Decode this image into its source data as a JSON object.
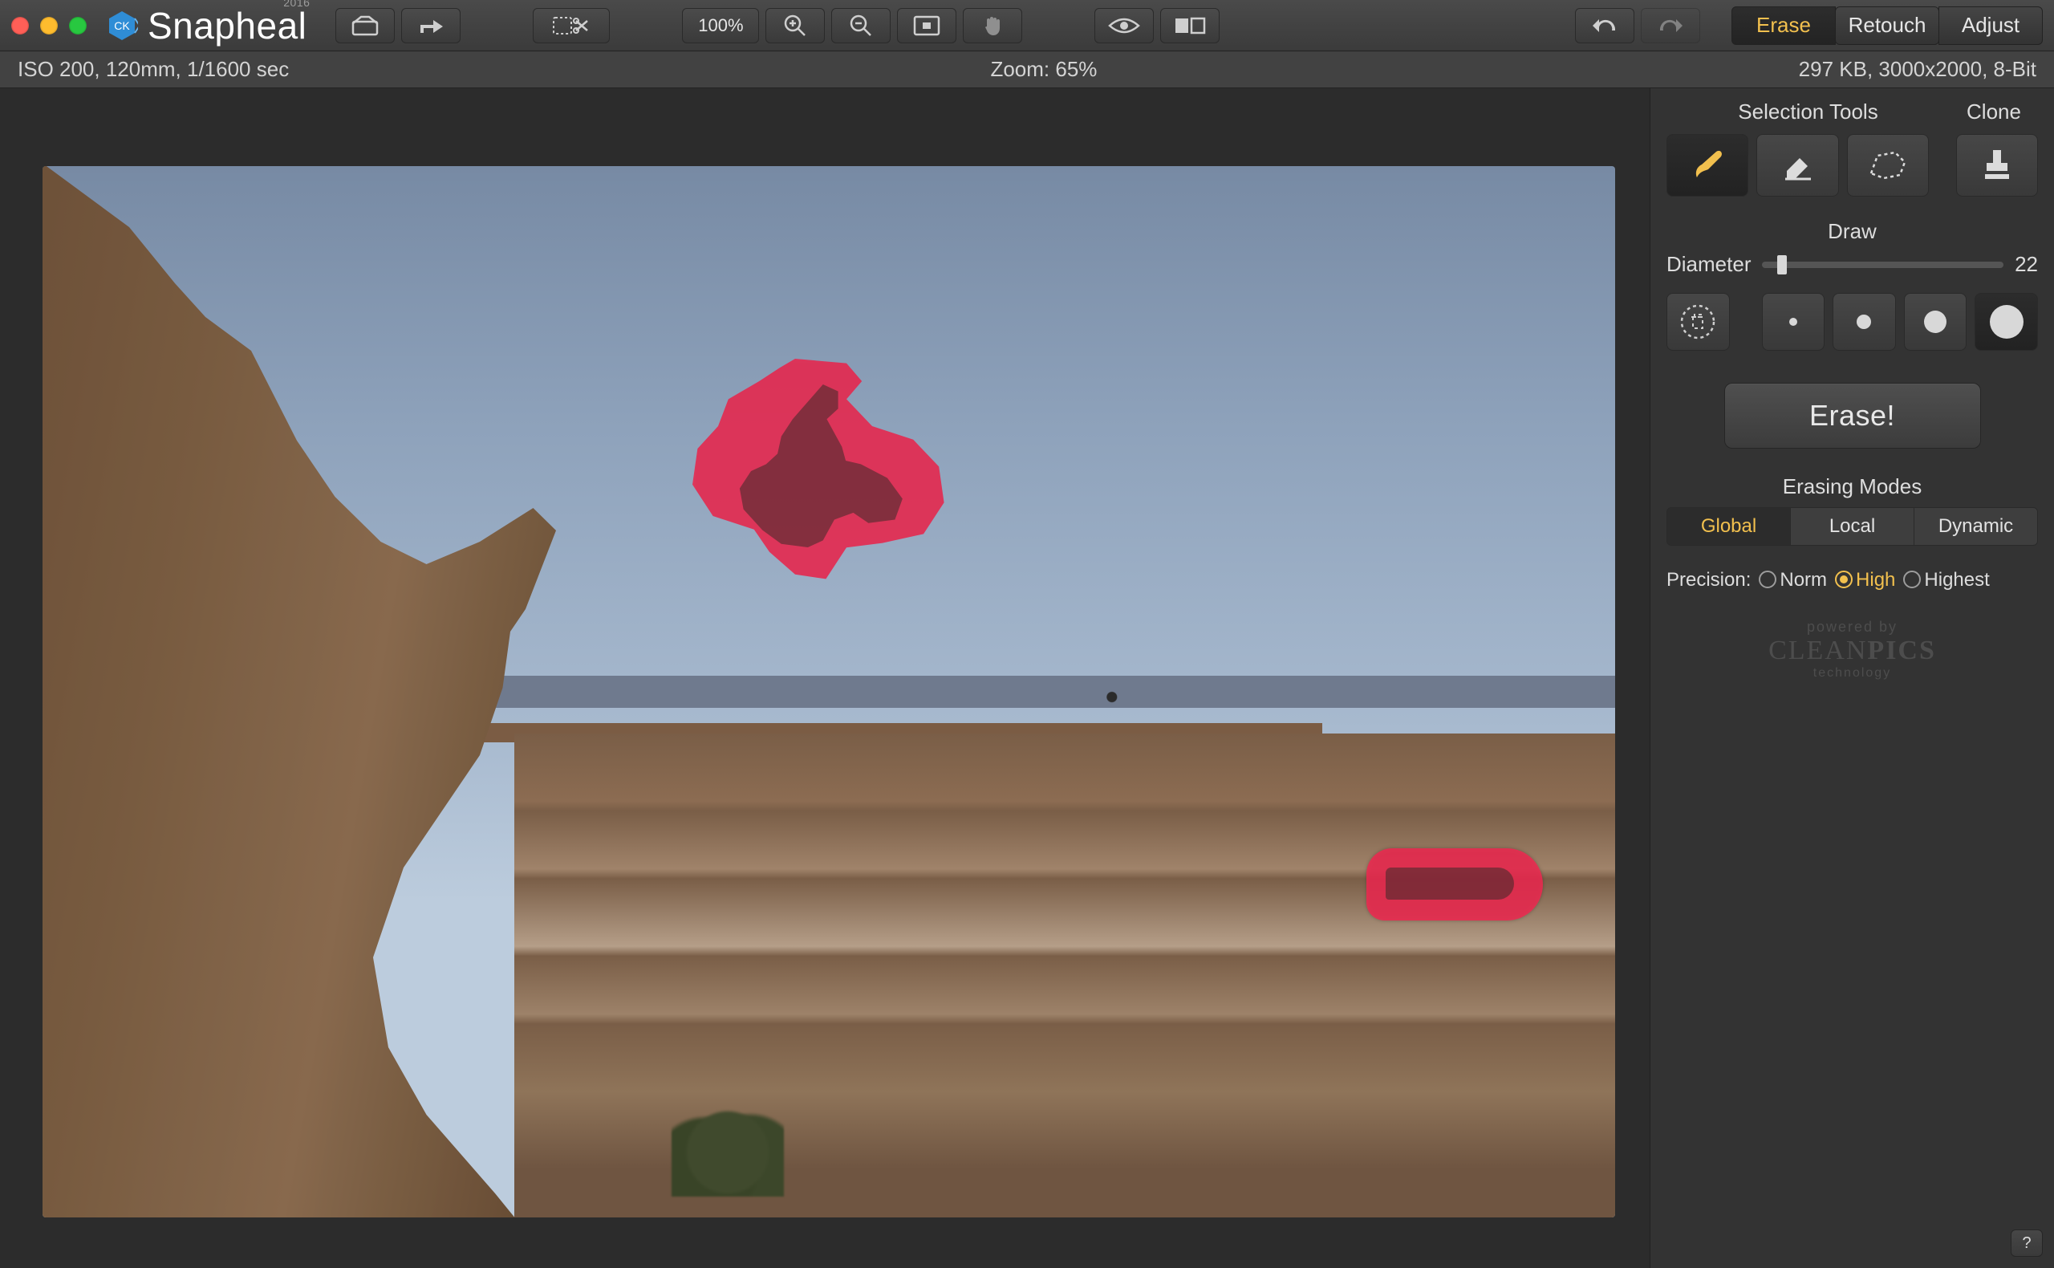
{
  "app": {
    "name": "Snapheal",
    "year": "2016",
    "badge": "CK"
  },
  "toolbar": {
    "open_icon": "box-open-icon",
    "share_icon": "share-arrow-icon",
    "crop_icon": "crop-scissors-icon",
    "zoom_pct": "100%",
    "zoom_in_icon": "zoom-in-icon",
    "zoom_out_icon": "zoom-out-icon",
    "fit_icon": "fit-screen-icon",
    "hand_icon": "hand-pan-icon",
    "preview_icon": "eye-preview-icon",
    "compare_icon": "compare-split-icon",
    "undo_icon": "undo-arrow-icon",
    "redo_icon": "redo-arrow-icon"
  },
  "modes": {
    "tabs": [
      "Erase",
      "Retouch",
      "Adjust"
    ],
    "active": "Erase"
  },
  "infobar": {
    "left": "ISO 200, 120mm, 1/1600 sec",
    "zoom": "Zoom: 65%",
    "right": "297 KB, 3000x2000, 8-Bit"
  },
  "panel": {
    "selection_tools_label": "Selection Tools",
    "clone_label": "Clone",
    "tools": [
      {
        "id": "brush-tool",
        "icon": "brush-icon",
        "active": true
      },
      {
        "id": "eraser-tool",
        "icon": "eraser-icon",
        "active": false
      },
      {
        "id": "lasso-tool",
        "icon": "lasso-icon",
        "active": false
      }
    ],
    "clone_tool": {
      "id": "clone-stamp-tool",
      "icon": "stamp-icon"
    },
    "draw_label": "Draw",
    "diameter_label": "Diameter",
    "diameter_value": "22",
    "diameter_thumb_pct": 6,
    "presets": [
      {
        "id": "clear-selection",
        "icon": "trash-dashed-icon"
      },
      {
        "id": "brush-size-xs",
        "size": "dot1"
      },
      {
        "id": "brush-size-sm",
        "size": "dot2"
      },
      {
        "id": "brush-size-md",
        "size": "dot3"
      },
      {
        "id": "brush-size-lg",
        "size": "dot4",
        "active": true
      }
    ],
    "erase_button": "Erase!",
    "erasing_modes_label": "Erasing Modes",
    "erasing_modes": {
      "options": [
        "Global",
        "Local",
        "Dynamic"
      ],
      "active": "Global"
    },
    "precision_label": "Precision:",
    "precision": {
      "options": [
        "Norm",
        "High",
        "Highest"
      ],
      "active": "High"
    },
    "powered": {
      "small": "powered by",
      "brand_a": "CLEAN",
      "brand_b": "PICS",
      "tech": "technology"
    },
    "help": "?"
  }
}
